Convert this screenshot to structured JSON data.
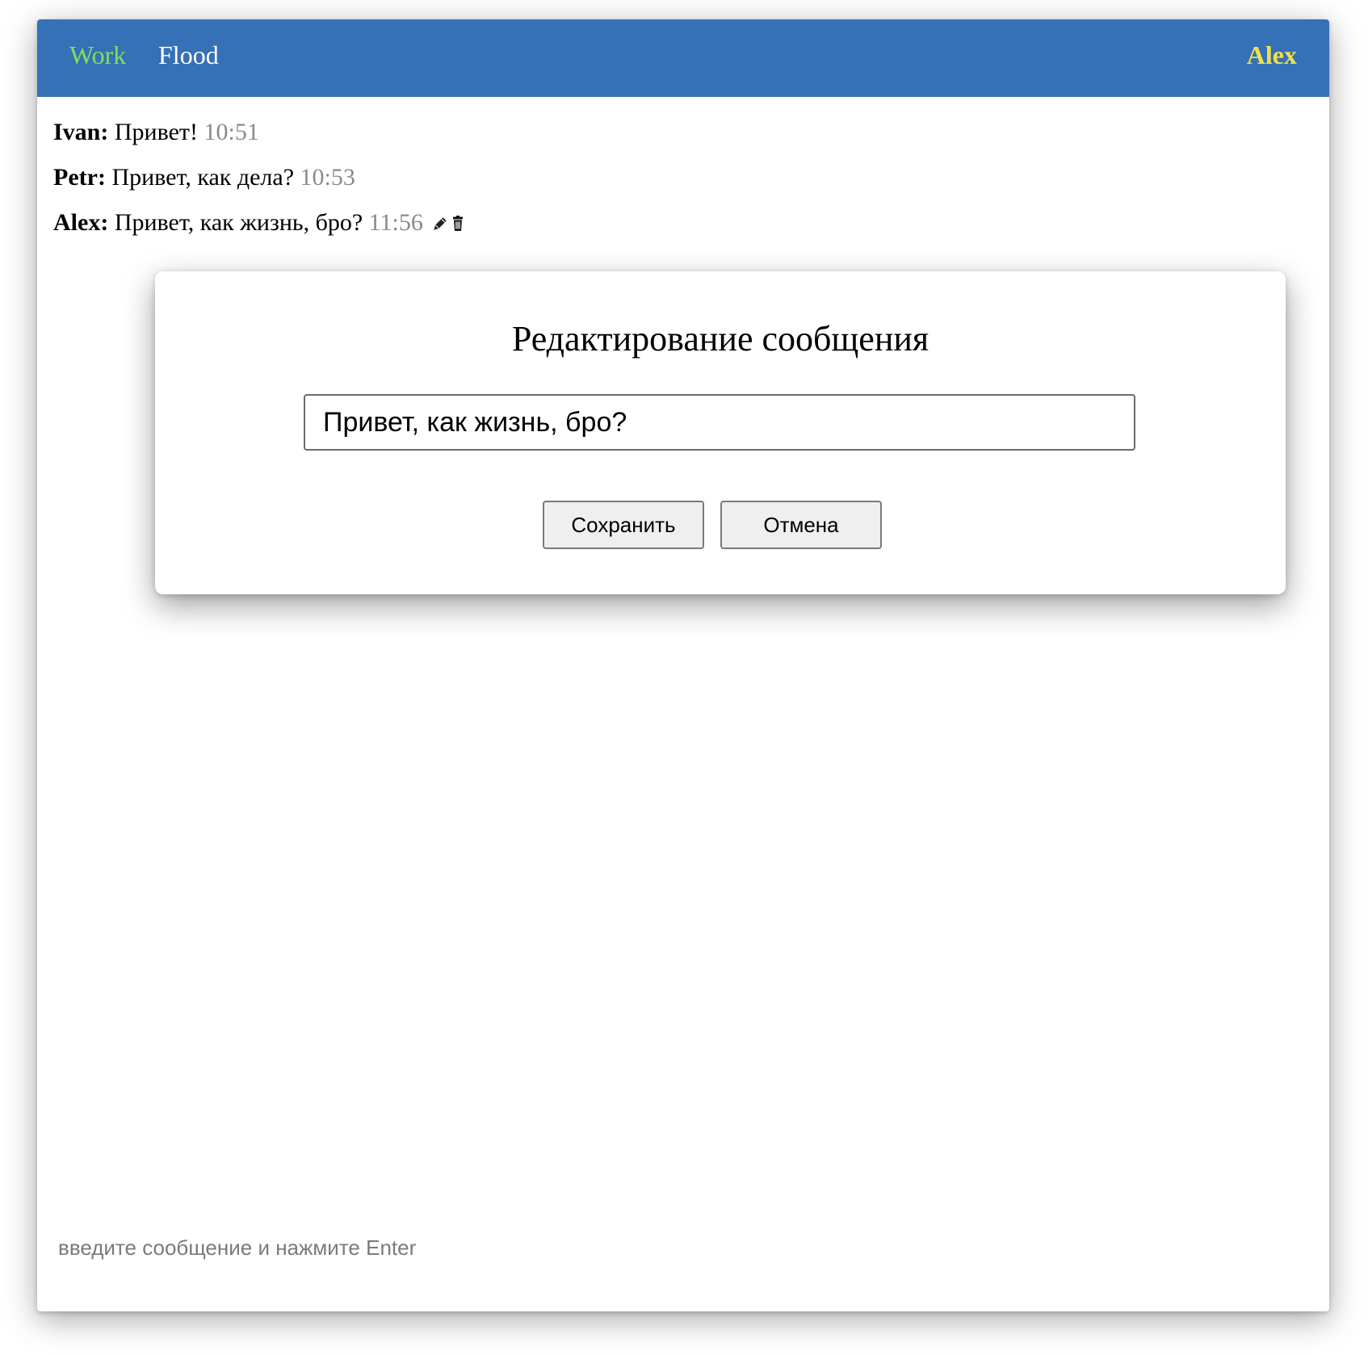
{
  "header": {
    "channels": [
      {
        "label": "Work",
        "active": true,
        "color": "#7fe05c"
      },
      {
        "label": "Flood",
        "active": false,
        "color": "#ffffff"
      }
    ],
    "username": "Alex",
    "username_color": "#f2e04a",
    "background": "#3670b6"
  },
  "messages": [
    {
      "author": "Ivan:",
      "text": "Привет!",
      "time": "10:51"
    },
    {
      "author": "Petr:",
      "text": "Привет, как дела?",
      "time": "10:53"
    },
    {
      "author": "Alex:",
      "text": "Привет, как жизнь, бро?",
      "time": "11:56",
      "icons": [
        "pencil-icon",
        "trash-icon"
      ]
    }
  ],
  "composer": {
    "placeholder": "введите сообщение и нажмите Enter",
    "value": ""
  },
  "modal": {
    "title": "Редактирование сообщения",
    "input_value": "Привет, как жизнь, бро?",
    "save_label": "Сохранить",
    "cancel_label": "Отмена"
  }
}
